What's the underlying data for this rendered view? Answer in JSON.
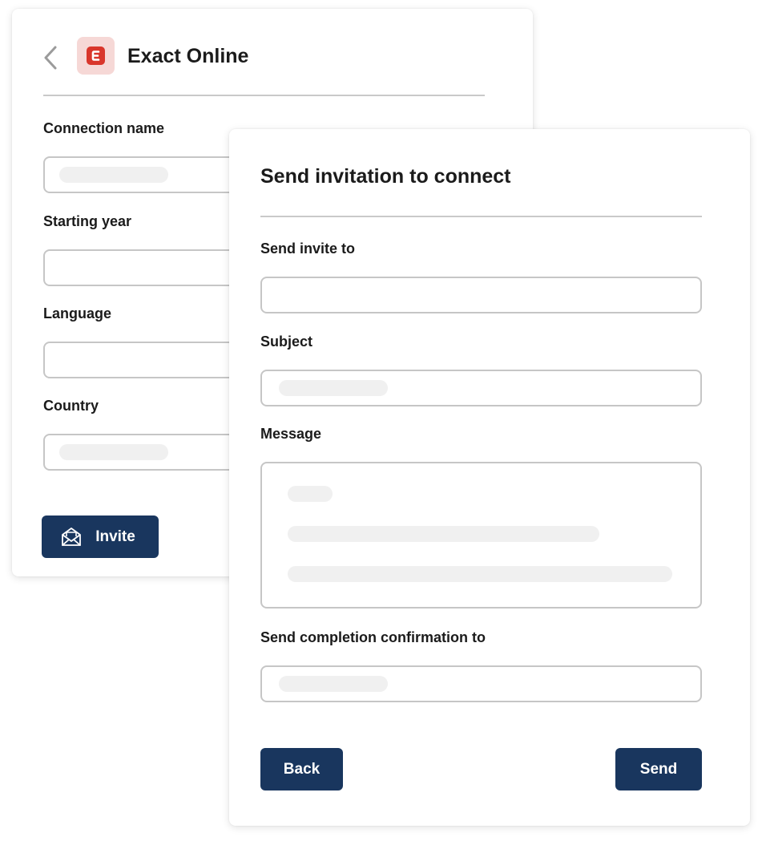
{
  "integration": {
    "title": "Exact Online",
    "logo_letter": "E",
    "logo_color": "#d9362b",
    "logo_bg": "#f6d8d6"
  },
  "back_form": {
    "fields": [
      {
        "label": "Connection name",
        "has_value": true
      },
      {
        "label": "Starting year",
        "has_value": false
      },
      {
        "label": "Language",
        "has_value": false
      },
      {
        "label": "Country",
        "has_value": true
      }
    ],
    "invite_label": "Invite"
  },
  "invite_dialog": {
    "title": "Send invitation to connect",
    "send_to_label": "Send invite to",
    "subject_label": "Subject",
    "message_label": "Message",
    "confirmation_label": "Send completion confirmation to",
    "back_label": "Back",
    "send_label": "Send"
  },
  "colors": {
    "primary": "#19365e",
    "border": "#c6c6c6",
    "skeleton": "#f0f0f0"
  }
}
